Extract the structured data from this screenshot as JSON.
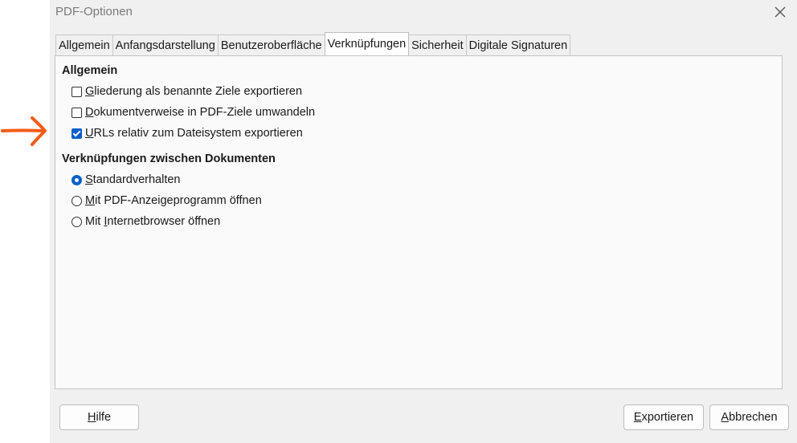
{
  "window": {
    "title": "PDF-Optionen",
    "close_icon": "close-icon"
  },
  "tabs": [
    {
      "label": "Allgemein",
      "active": false
    },
    {
      "label": "Anfangsdarstellung",
      "active": false
    },
    {
      "label": "Benutzeroberfläche",
      "active": false
    },
    {
      "label": "Verknüpfungen",
      "active": true
    },
    {
      "label": "Sicherheit",
      "active": false
    },
    {
      "label": "Digitale Signaturen",
      "active": false
    }
  ],
  "general": {
    "heading": "Allgemein",
    "options": [
      {
        "mnemonic": "G",
        "rest": "liederung als benannte Ziele exportieren",
        "checked": false
      },
      {
        "mnemonic": "D",
        "rest": "okumentverweise in PDF-Ziele umwandeln",
        "checked": false
      },
      {
        "mnemonic": "U",
        "rest": "RLs relativ zum Dateisystem exportieren",
        "checked": true
      }
    ]
  },
  "cross_doc": {
    "heading": "Verknüpfungen zwischen Dokumenten",
    "options": [
      {
        "before": "",
        "mnemonic": "S",
        "rest": "tandardverhalten",
        "selected": true
      },
      {
        "before": "",
        "mnemonic": "M",
        "rest": "it PDF-Anzeigeprogramm öffnen",
        "selected": false
      },
      {
        "before": "Mit ",
        "mnemonic": "I",
        "rest": "nternetbrowser öffnen",
        "selected": false
      }
    ]
  },
  "buttons": {
    "help": {
      "mnemonic": "H",
      "rest": "ilfe"
    },
    "export": {
      "mnemonic": "E",
      "rest": "xportieren"
    },
    "cancel": {
      "mnemonic": "A",
      "rest": "bbrechen"
    }
  },
  "annotation": {
    "arrow_color": "#f25c19",
    "arrow_icon": "arrow-right-icon"
  },
  "colors": {
    "accent": "#0a5fc8",
    "dialog_bg": "#f0f0f0"
  }
}
